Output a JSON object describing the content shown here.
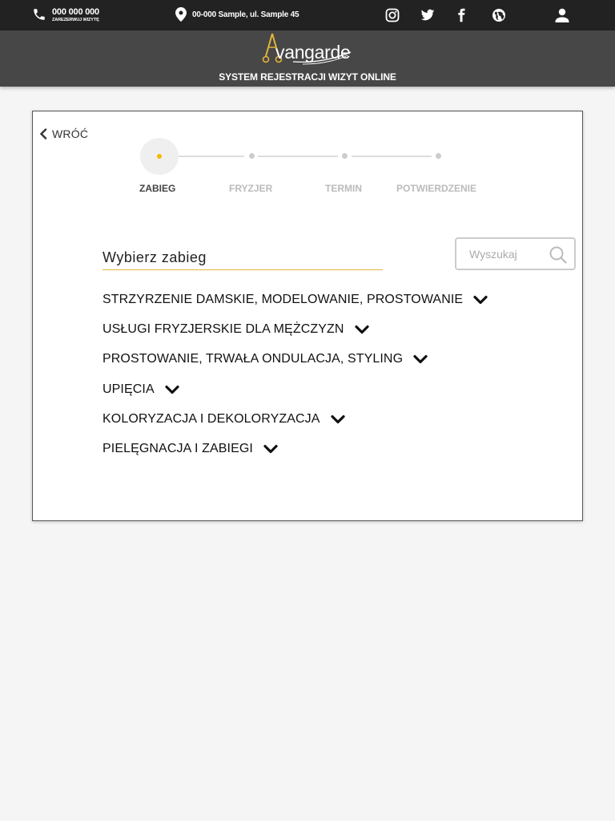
{
  "topbar": {
    "phone": "000 000 000",
    "phone_sub": "ZAREZERWUJ WIZYTĘ",
    "address": "00-000 Sample, ul. Sample 45",
    "icons": [
      "phone-icon",
      "map-pin-icon",
      "instagram-icon",
      "twitter-icon",
      "facebook-icon",
      "globe-icon",
      "user-icon"
    ]
  },
  "brand": {
    "logo_text": "vangarde",
    "system_title": "SYSTEM REJESTRACJI WIZYT ONLINE",
    "accent": "#f5b800"
  },
  "card": {
    "back_label": "WRÓĆ",
    "steps": [
      {
        "label": "ZABIEG",
        "active": true
      },
      {
        "label": "FRYZJER",
        "active": false
      },
      {
        "label": "TERMIN",
        "active": false
      },
      {
        "label": "POTWIERDZENIE",
        "active": false
      }
    ],
    "choose_title": "Wybierz zabieg",
    "search_placeholder": "Wyszukaj",
    "categories": [
      {
        "label": "STRZYRZENIE DAMSKIE, MODELOWANIE, PROSTOWANIE"
      },
      {
        "label": "USŁUGI FRYZJERSKIE DLA MĘŻCZYZN"
      },
      {
        "label": "PROSTOWANIE, TRWAŁA ONDULACJA, STYLING"
      },
      {
        "label": "UPIĘCIA"
      },
      {
        "label": "KOLORYZACJA I DEKOLORYZACJA"
      },
      {
        "label": "PIELĘGNACJA I ZABIEGI"
      }
    ]
  }
}
